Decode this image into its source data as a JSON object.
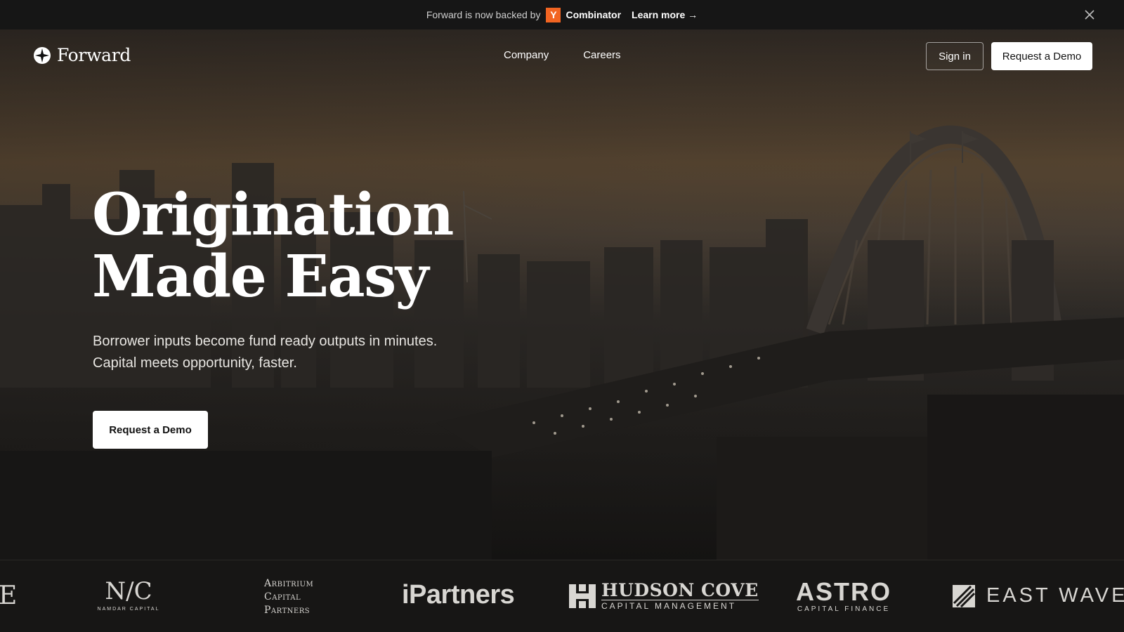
{
  "announcement": {
    "text": "Forward is now backed by",
    "yc_letter": "Y",
    "yc_name": "Combinator",
    "learn_more": "Learn more →",
    "close_icon": "close-icon"
  },
  "nav": {
    "brand": "Forward",
    "brand_icon": "compass-star-icon",
    "links": [
      "Company",
      "Careers"
    ],
    "sign_in": "Sign in",
    "request_demo": "Request a Demo"
  },
  "hero": {
    "headline_line1": "Origination",
    "headline_line2": "Made Easy",
    "subtitle_line1": "Borrower inputs become fund ready outputs in minutes.",
    "subtitle_line2": "Capital meets opportunity, faster.",
    "cta": "Request a Demo",
    "background": "harbour-bridge-city-dusk-photo"
  },
  "logos": {
    "partial": "E",
    "namdar_mark": "N/C",
    "namdar_text": "NAMDAR CAPITAL",
    "arbitrium": [
      "Arbitrium",
      "Capital",
      "Partners"
    ],
    "ipartners": "iPartners",
    "hudson_line1": "HUDSON COVE",
    "hudson_line2": "CAPITAL MANAGEMENT",
    "astro_line1": "ASTRO",
    "astro_line2": "CAPITAL FINANCE",
    "eastwave": "EAST WAVE F"
  },
  "colors": {
    "yc_orange": "#f26522",
    "announce_bg": "#161616",
    "cta_bg": "#ffffff"
  }
}
